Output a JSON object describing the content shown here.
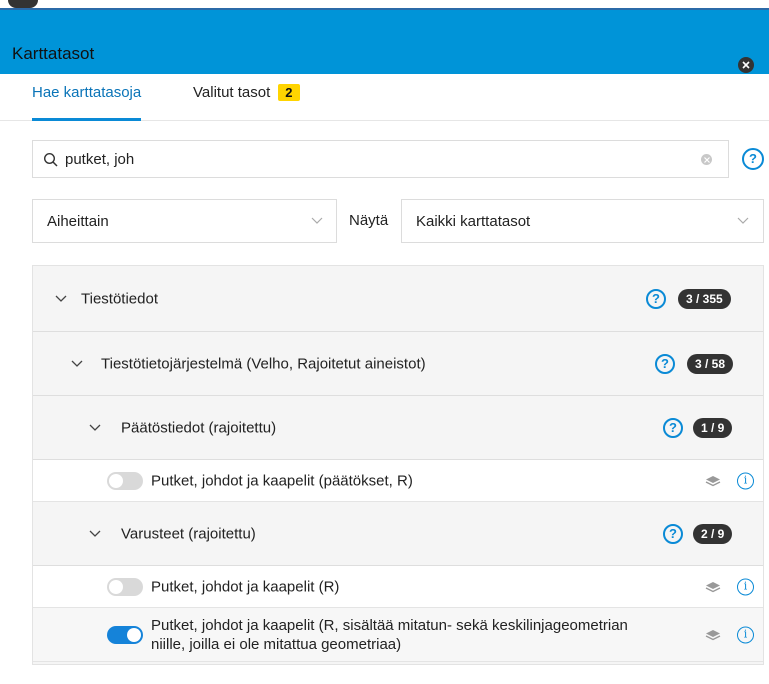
{
  "header": {
    "title": "Karttatasot"
  },
  "tabs": [
    {
      "label": "Hae karttatasoja",
      "active": true
    },
    {
      "label": "Valitut tasot",
      "badge": "2"
    }
  ],
  "search": {
    "value": "putket, joh",
    "help": "?"
  },
  "filters": {
    "grouping": "Aiheittain",
    "show_label": "Näytä",
    "show_value": "Kaikki karttatasot"
  },
  "tree": {
    "root": {
      "label": "Tiestötiedot",
      "count": "3 / 355",
      "help": "?"
    },
    "group": {
      "label": "Tiestötietojärjestelmä (Velho, Rajoitetut aineistot)",
      "count": "3 / 58",
      "help": "?"
    },
    "subgroups": [
      {
        "label": "Päätöstiedot (rajoitettu)",
        "count": "1 / 9",
        "help": "?",
        "layers": [
          {
            "name": "Putket, johdot ja kaapelit (päätökset, R)",
            "enabled": false,
            "info": "i"
          }
        ]
      },
      {
        "label": "Varusteet (rajoitettu)",
        "count": "2 / 9",
        "help": "?",
        "layers": [
          {
            "name": "Putket, johdot ja kaapelit (R)",
            "enabled": false,
            "info": "i"
          },
          {
            "name_line1": "Putket, johdot ja kaapelit (R, sisältää mitatun- sekä keskilinjageometrian",
            "name_line2": "niille, joilla ei ole mitattua geometriaa)",
            "enabled": true,
            "info": "i"
          }
        ]
      }
    ]
  },
  "colors": {
    "header": "#0094d8",
    "accent": "#0a8ad6",
    "badge": "#ffd400",
    "toggle_on": "#1583d9"
  }
}
